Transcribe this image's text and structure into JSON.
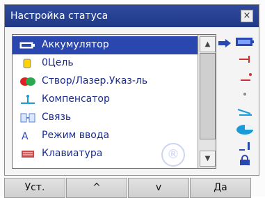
{
  "window": {
    "title": "Настройка статуса",
    "close_symbol": "×"
  },
  "list": {
    "items": [
      {
        "label": "Аккумулятор",
        "icon": "battery-icon",
        "selected": true
      },
      {
        "label": "0Цель",
        "icon": "target-icon",
        "selected": false
      },
      {
        "label": "Створ/Лазер.Указ-ль",
        "icon": "laser-pointer-icon",
        "selected": false
      },
      {
        "label": "Компенсатор",
        "icon": "compensator-icon",
        "selected": false
      },
      {
        "label": "Связь",
        "icon": "connection-icon",
        "selected": false
      },
      {
        "label": "Режим ввода",
        "icon": "input-mode-icon",
        "selected": false
      },
      {
        "label": "Клавиатура",
        "icon": "keyboard-icon",
        "selected": false
      }
    ]
  },
  "scrollbar": {
    "up_symbol": "▲",
    "down_symbol": "▼"
  },
  "status_rail": {
    "icons": [
      "battery-status-icon",
      "target-status-icon",
      "laser-status-icon",
      "compensator-status-icon",
      "connection-status-icon",
      "disk-status-icon",
      "input-mode-status-icon",
      "lock-status-icon"
    ],
    "colors": {
      "accent": "#2a47b0",
      "highlight": "#2f4a9d",
      "red": "#cf2f2f",
      "cyan": "#1a9ad6"
    }
  },
  "softkeys": {
    "keys": [
      {
        "label": "Уст."
      },
      {
        "label": "^"
      },
      {
        "label": "v"
      },
      {
        "label": "Да"
      }
    ]
  },
  "watermark": {
    "symbol": "®"
  }
}
